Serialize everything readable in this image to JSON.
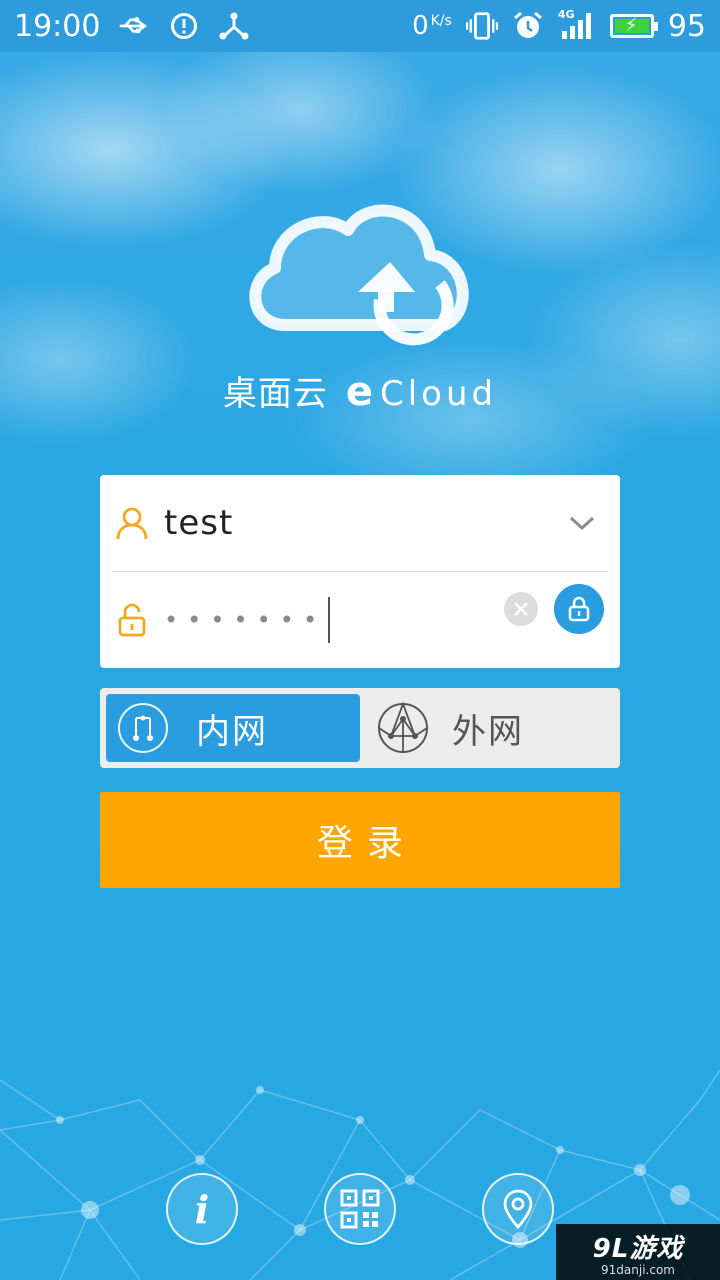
{
  "status_bar": {
    "time": "19:00",
    "net_speed_value": "0",
    "net_speed_unit": "K/s",
    "network_type": "4G",
    "battery_level": "95"
  },
  "brand": {
    "chinese_name": "桌面云",
    "e_letter": "e",
    "cloud_text": "Cloud"
  },
  "login_form": {
    "username": "test",
    "password_masked": "•••••••"
  },
  "network_mode": {
    "inner_label": "内网",
    "outer_label": "外网",
    "selected": "inner"
  },
  "login_button_label": "登录",
  "watermark": {
    "main": "9L游戏",
    "sub": "91danji.com"
  },
  "colors": {
    "accent_blue": "#2a9de0",
    "login_orange": "#ffa500",
    "username_icon_orange": "#f5a623"
  }
}
